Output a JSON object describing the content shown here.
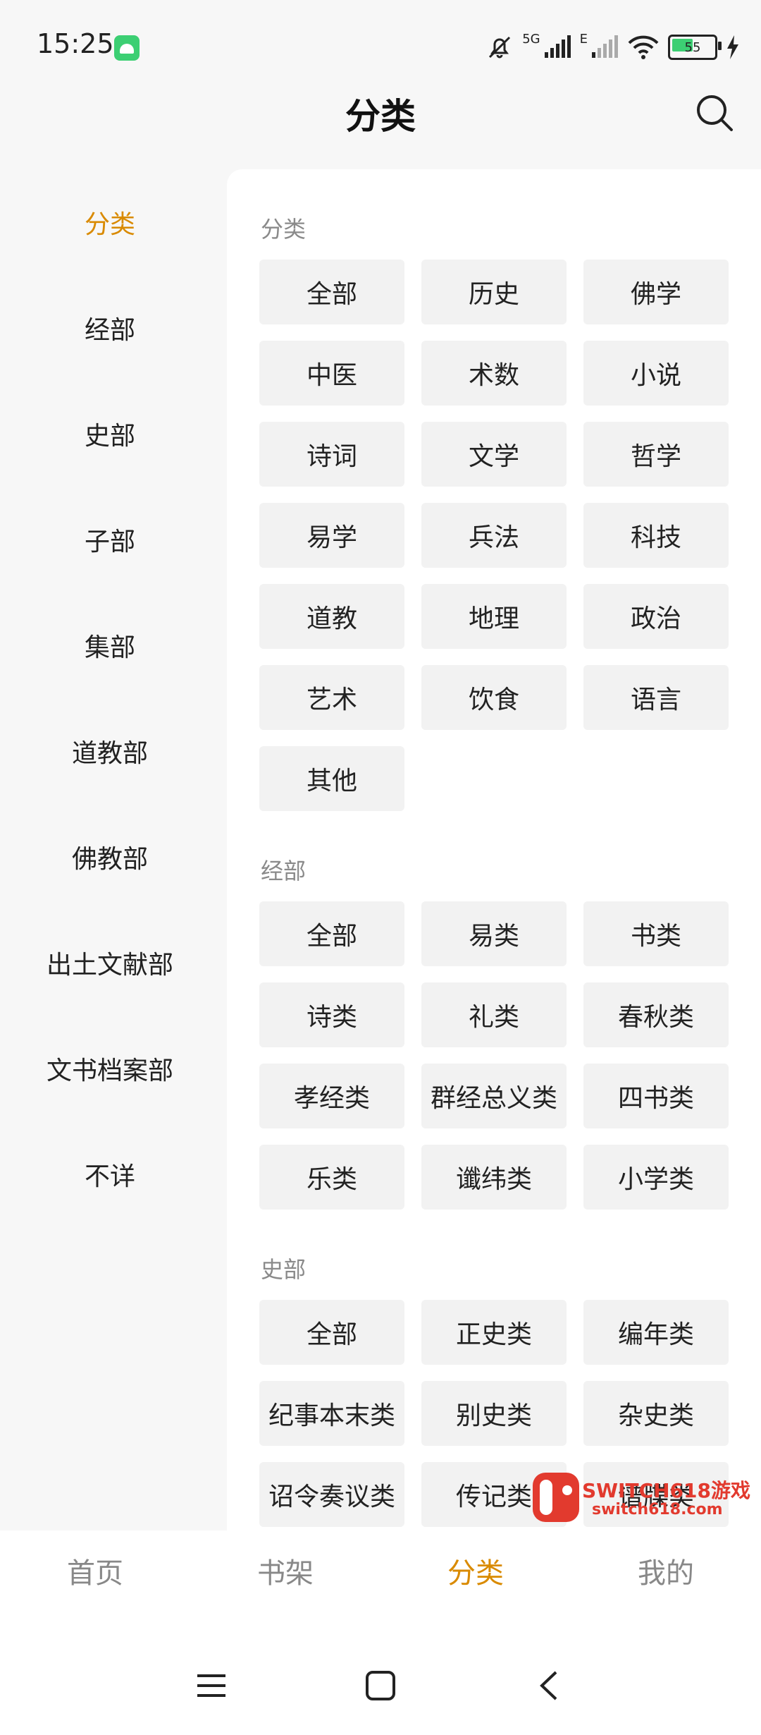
{
  "status_bar": {
    "time": "15:25",
    "network_label": "5G",
    "network_label_2": "E",
    "battery": "55",
    "battery_level": 0.55
  },
  "header": {
    "title": "分类"
  },
  "sidebar": {
    "items": [
      {
        "label": "分类",
        "active": true
      },
      {
        "label": "经部"
      },
      {
        "label": "史部"
      },
      {
        "label": "子部"
      },
      {
        "label": "集部"
      },
      {
        "label": "道教部"
      },
      {
        "label": "佛教部"
      },
      {
        "label": "出土文献部"
      },
      {
        "label": "文书档案部"
      },
      {
        "label": "不详"
      }
    ]
  },
  "sections": [
    {
      "title": "分类",
      "chips": [
        "全部",
        "历史",
        "佛学",
        "中医",
        "术数",
        "小说",
        "诗词",
        "文学",
        "哲学",
        "易学",
        "兵法",
        "科技",
        "道教",
        "地理",
        "政治",
        "艺术",
        "饮食",
        "语言",
        "其他"
      ]
    },
    {
      "title": "经部",
      "chips": [
        "全部",
        "易类",
        "书类",
        "诗类",
        "礼类",
        "春秋类",
        "孝经类",
        "群经总义类",
        "四书类",
        "乐类",
        "谶纬类",
        "小学类"
      ]
    },
    {
      "title": "史部",
      "chips": [
        "全部",
        "正史类",
        "编年类",
        "纪事本末类",
        "别史类",
        "杂史类",
        "诏令奏议类",
        "传记类",
        "谱牒类"
      ]
    }
  ],
  "bottom_nav": {
    "items": [
      {
        "label": "首页"
      },
      {
        "label": "书架"
      },
      {
        "label": "分类",
        "active": true
      },
      {
        "label": "我的"
      }
    ]
  },
  "watermark": {
    "text": "SWITCH618游戏",
    "sub": "switch618.com"
  },
  "colors": {
    "accent": "#d98a00",
    "chip_bg": "#f2f2f2",
    "section_title": "#8a8a8a"
  }
}
